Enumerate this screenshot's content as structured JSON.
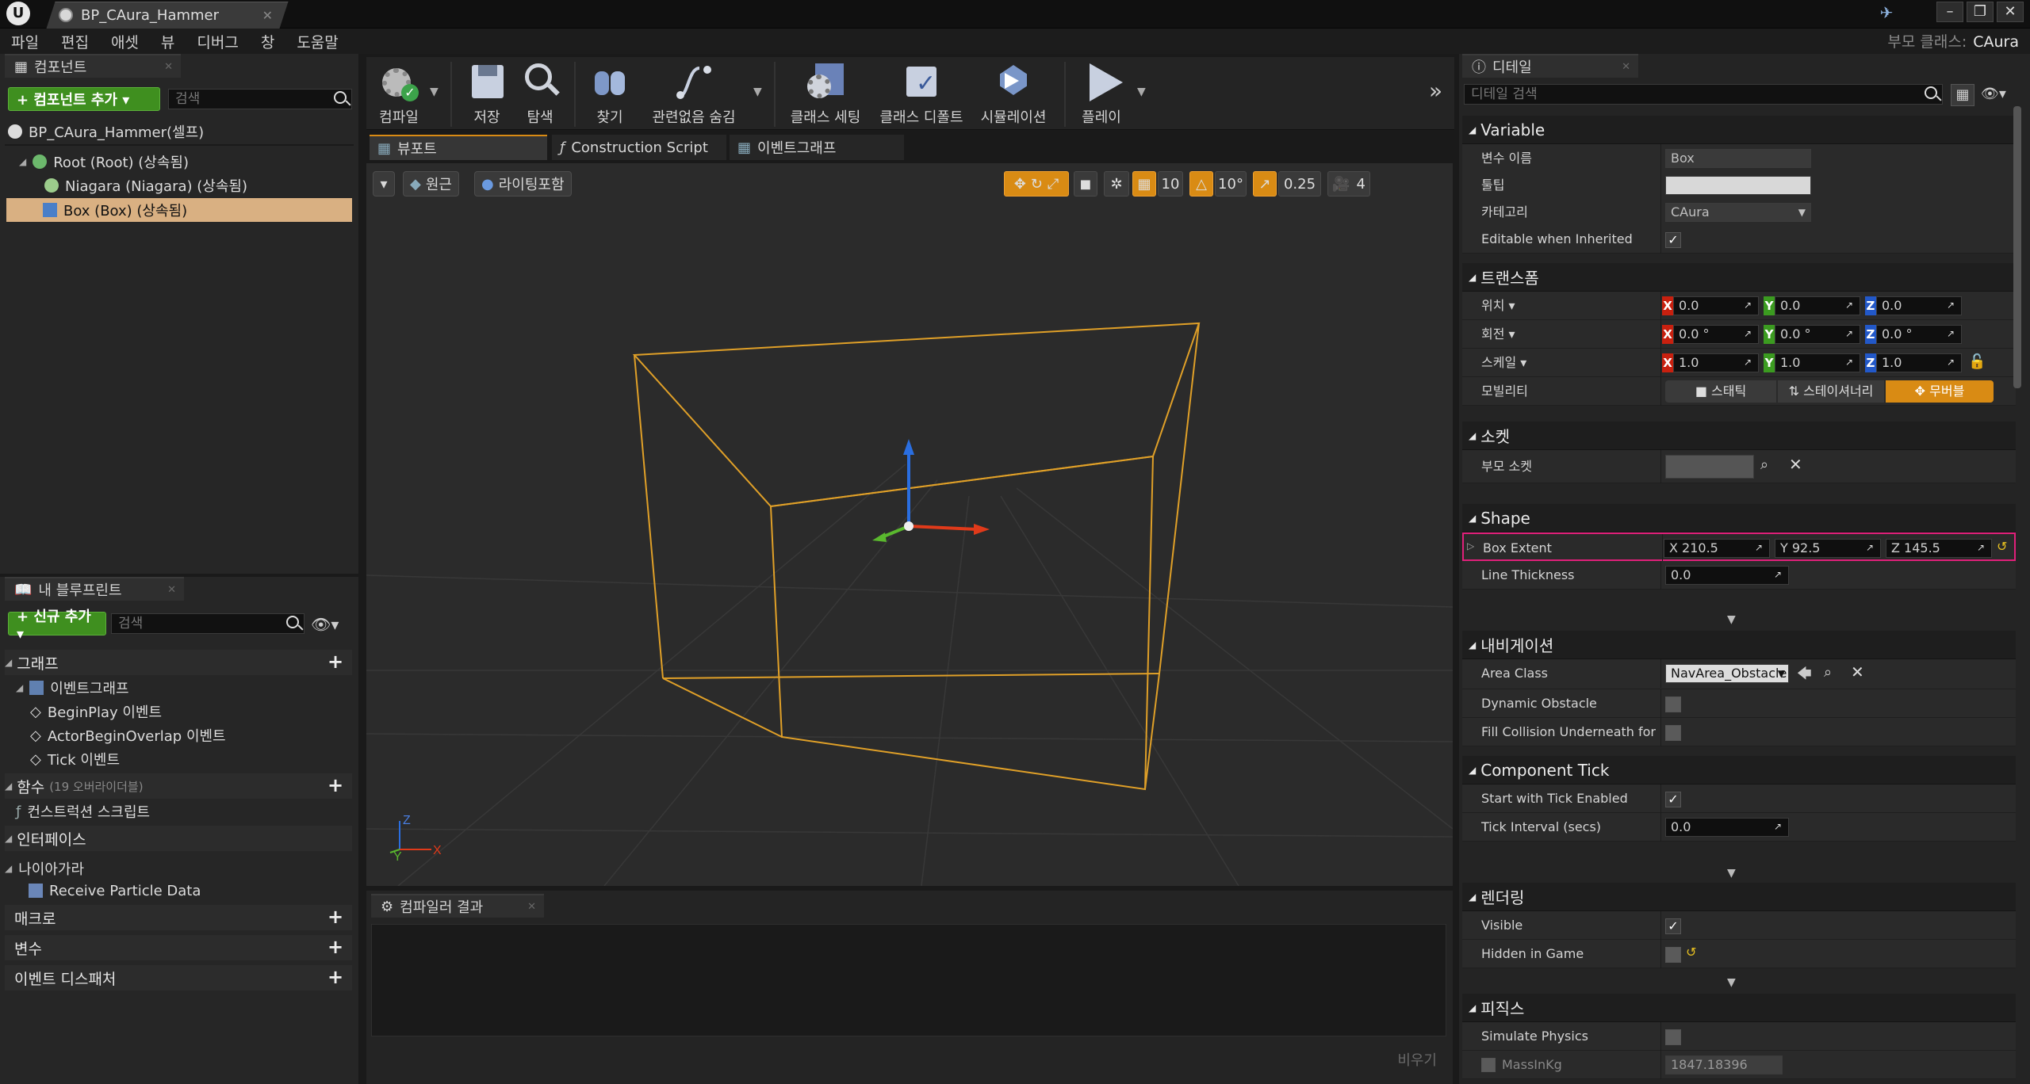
{
  "title_bar": {
    "tab_title": "BP_CAura_Hammer"
  },
  "menu": {
    "items": [
      "파일",
      "편집",
      "애셋",
      "뷰",
      "디버그",
      "창",
      "도움말"
    ],
    "parent_class_label": "부모 클래스:",
    "parent_class_value": "CAura"
  },
  "components_panel": {
    "tab_label": "컴포넌트",
    "add_button": "+ 컴포넌트 추가 ▾",
    "search_placeholder": "검색",
    "self_item": "BP_CAura_Hammer(셀프)",
    "tree": [
      {
        "label": "Root (Root) (상속됨)"
      },
      {
        "label": "Niagara (Niagara) (상속됨)"
      },
      {
        "label": "Box (Box) (상속됨)",
        "selected": true
      }
    ]
  },
  "my_blueprint_panel": {
    "tab_label": "내 블루프린트",
    "add_button": "+ 신규 추가 ▾",
    "search_placeholder": "검색",
    "graphs_header": "그래프",
    "event_graph": "이벤트그래프",
    "events": [
      "BeginPlay 이벤트",
      "ActorBeginOverlap 이벤트",
      "Tick 이벤트"
    ],
    "functions_header": "함수",
    "functions_override": "(19 오버라이더블)",
    "construction_script": "컨스트럭션 스크립트",
    "interfaces_header": "인터페이스",
    "niagara_header": "나이아가라",
    "receive_particle": "Receive Particle Data",
    "macros_header": "매크로",
    "variables_header": "변수",
    "dispatchers_header": "이벤트 디스패처"
  },
  "toolbar": {
    "compile": "컴파일",
    "save": "저장",
    "browse": "탐색",
    "find": "찾기",
    "hide_unrelated": "관련없음 숨김",
    "class_settings": "클래스 세팅",
    "class_defaults": "클래스 디폴트",
    "simulation": "시뮬레이션",
    "play": "플레이"
  },
  "editor_tabs": {
    "viewport": "뷰포트",
    "construction": "Construction Script",
    "event_graph": "이벤트그래프"
  },
  "viewport": {
    "perspective_btn": "원근",
    "lighting_btn": "라이팅포함",
    "grid_snap": "10",
    "rot_snap": "10°",
    "scale_snap": "0.25",
    "cam_speed": "4"
  },
  "compiler": {
    "tab_label": "컴파일러 결과",
    "clear_label": "비우기"
  },
  "details": {
    "tab_label": "디테일",
    "search_placeholder": "디테일 검색",
    "variable": {
      "header": "Variable",
      "var_name_label": "변수 이름",
      "var_name_value": "Box",
      "tooltip_label": "툴팁",
      "tooltip_value": "",
      "category_label": "카테고리",
      "category_value": "CAura",
      "editable_label": "Editable when Inherited"
    },
    "transform": {
      "header": "트랜스폼",
      "location_label": "위치 ▾",
      "location": [
        "0.0",
        "0.0",
        "0.0"
      ],
      "rotation_label": "회전 ▾",
      "rotation": [
        "0.0 °",
        "0.0 °",
        "0.0 °"
      ],
      "scale_label": "스케일 ▾",
      "scale": [
        "1.0",
        "1.0",
        "1.0"
      ],
      "mobility_label": "모빌리티",
      "mobility_options": [
        "스태틱",
        "스테이셔너리",
        "무버블"
      ]
    },
    "sockets": {
      "header": "소켓",
      "parent_socket_label": "부모 소켓"
    },
    "shape": {
      "header": "Shape",
      "box_extent_label": "Box Extent",
      "box_extent": [
        "210.5",
        "92.5",
        "145.5"
      ],
      "line_thickness_label": "Line Thickness",
      "line_thickness": "0.0"
    },
    "navigation": {
      "header": "내비게이션",
      "area_class_label": "Area Class",
      "area_class_value": "NavArea_Obstacle",
      "dynamic_obstacle_label": "Dynamic Obstacle",
      "fill_collision_label": "Fill Collision Underneath for Na"
    },
    "component_tick": {
      "header": "Component Tick",
      "start_tick_label": "Start with Tick Enabled",
      "tick_interval_label": "Tick Interval (secs)",
      "tick_interval": "0.0"
    },
    "rendering": {
      "header": "렌더링",
      "visible_label": "Visible",
      "hidden_label": "Hidden in Game"
    },
    "physics": {
      "header": "피직스",
      "simulate_label": "Simulate Physics",
      "mass_label": "MassInKg",
      "mass_value": "1847.18396"
    }
  },
  "colors": {
    "accent_orange": "#d98b14",
    "selection": "#d9b082",
    "highlight_pink": "#e0207a"
  }
}
